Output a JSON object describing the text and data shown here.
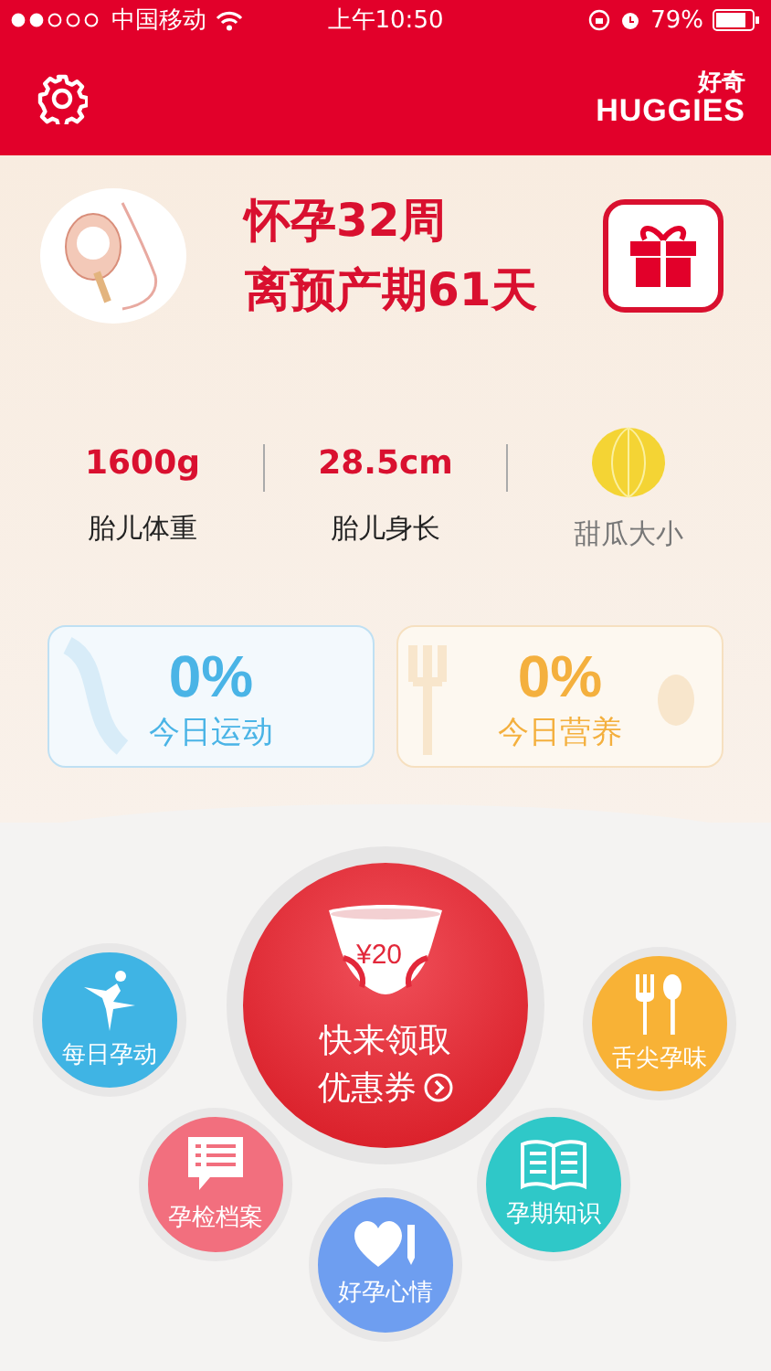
{
  "status_bar": {
    "carrier": "中国移动",
    "time": "上午10:50",
    "battery": "79%"
  },
  "header": {
    "logo_cn": "好奇",
    "logo_en": "HUGGIES"
  },
  "pregnancy": {
    "week": "怀孕32周",
    "countdown": "离预产期61天"
  },
  "stats": [
    {
      "kind": "value",
      "value": "1600g",
      "label": "胎儿体重"
    },
    {
      "kind": "value",
      "value": "28.5cm",
      "label": "胎儿身长"
    },
    {
      "kind": "fruit",
      "label": "甜瓜大小"
    }
  ],
  "daily": [
    {
      "kind": "exercise",
      "value": "0%",
      "label": "今日运动"
    },
    {
      "kind": "nutrition",
      "value": "0%",
      "label": "今日营养"
    }
  ],
  "coupon": {
    "amount": "¥20",
    "line1": "快来领取",
    "line2": "优惠券"
  },
  "menu": [
    {
      "kind": "dancer",
      "label": "每日孕动",
      "color": "#3fb4e4"
    },
    {
      "kind": "utensils",
      "label": "舌尖孕味",
      "color": "#f8b236"
    },
    {
      "kind": "checklist",
      "label": "孕检档案",
      "color": "#f26f7e"
    },
    {
      "kind": "heart-pen",
      "label": "好孕心情",
      "color": "#6e9ef0"
    },
    {
      "kind": "book",
      "label": "孕期知识",
      "color": "#2fc8c8"
    }
  ]
}
